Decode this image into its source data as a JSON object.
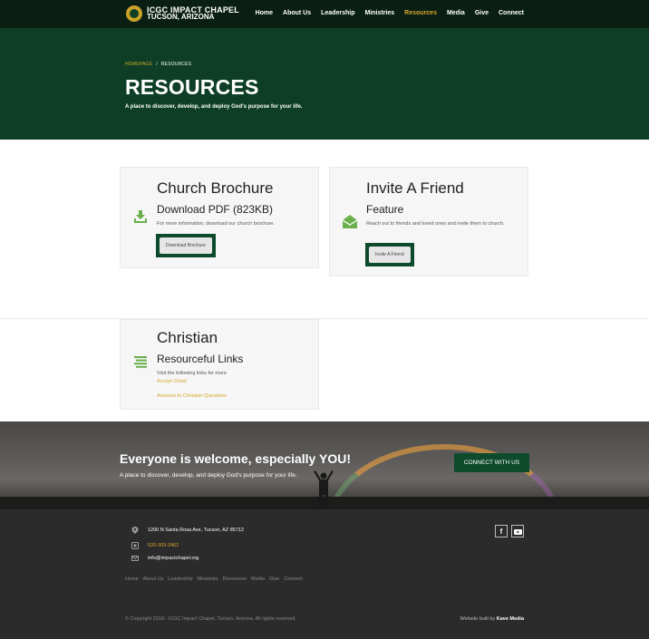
{
  "site": {
    "logo_line1": "ICGC IMPACT CHAPEL",
    "logo_line2": "TUCSON, ARIZONA"
  },
  "nav": [
    "Home",
    "About Us",
    "Leadership",
    "Ministries",
    "Resources",
    "Media",
    "Give",
    "Connect"
  ],
  "nav_active": "Resources",
  "hero": {
    "crumb_home": "HOMEPAGE",
    "crumb_sep": "/",
    "crumb_current": "RESOURCES",
    "title": "RESOURCES",
    "subtitle": "A place to discover, develop, and deploy God's purpose for your life."
  },
  "cards": {
    "brochure": {
      "title": "Church Brochure",
      "subtitle": "Download PDF (823KB)",
      "text": "For more information, download our church brochure.",
      "button": "Download Brochure",
      "icon": "download-icon"
    },
    "invite": {
      "title": "Invite A Friend",
      "subtitle": "Feature",
      "text": "Reach out to friends and loved ones and invite them to church.",
      "button": "Invite A Friend",
      "icon": "envelope-open-icon"
    },
    "christian": {
      "title": "Christian",
      "subtitle": "Resourceful Links",
      "text": "Visit the following links for more",
      "link1": "Accept Christ",
      "link2": "Answers to Christian Questions",
      "icon": "list-icon"
    }
  },
  "banner": {
    "heading": "Everyone is welcome, especially YOU!",
    "tagline": "A place to discover, develop, and deploy God's purpose for your life.",
    "button": "CONNECT WITH US"
  },
  "footer": {
    "address": "1200 N Santa Rosa Ave, Tucson, AZ 85712",
    "phone": "520-303-3462",
    "email": "info@impactchapel.org",
    "links": [
      "Home",
      "About Us",
      "Leadership",
      "Ministries",
      "Resources",
      "Media",
      "Give",
      "Connect"
    ],
    "copyright": "© Copyright 2018 - ICGC Impact Chapel, Tucson, Arizona. All rights reserved.",
    "built_label": "Website built by",
    "built_by": "Kave Media",
    "social": [
      "facebook-icon",
      "youtube-icon"
    ]
  },
  "colors": {
    "brand_green": "#0e3f26",
    "accent_gold": "#d6a72a",
    "icon_green": "#6ab04c",
    "footer_bg": "#2b2b2b"
  }
}
